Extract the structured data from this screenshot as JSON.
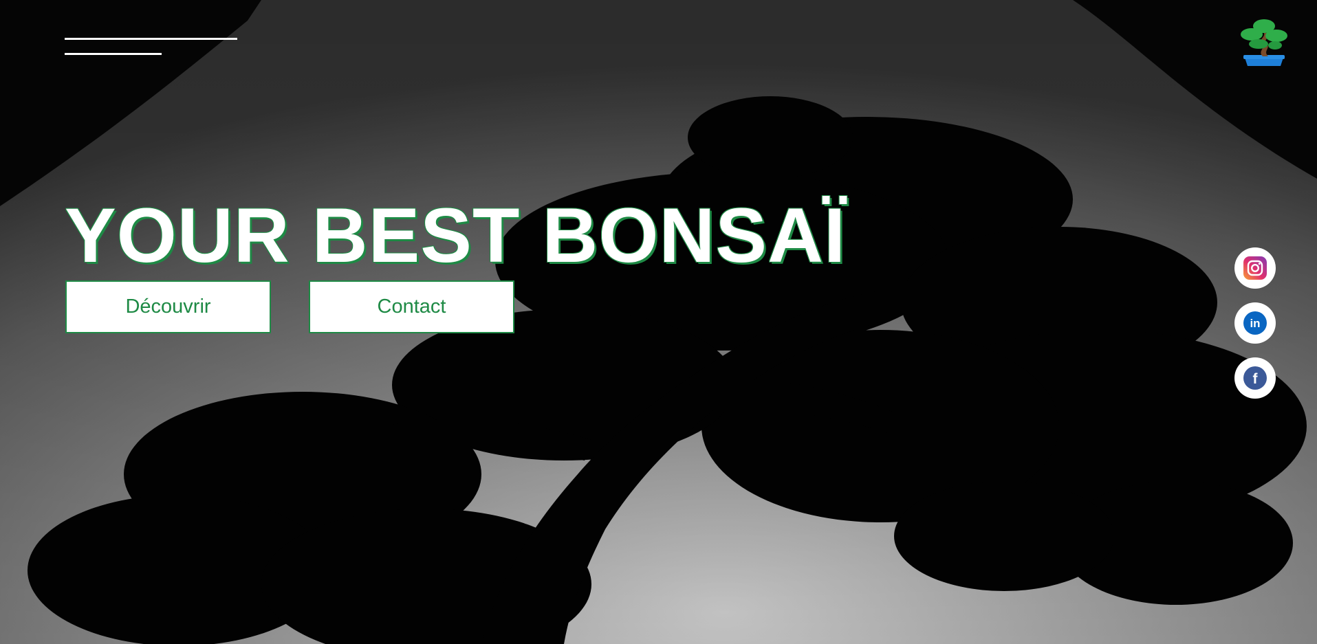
{
  "hero": {
    "title": "YOUR BEST BONSAÏ",
    "background": "monochrome photo of a bonsai tree silhouette against a textured wall"
  },
  "nav": {
    "menu_icon": "hamburger-menu-icon"
  },
  "logo": {
    "icon": "bonsai-tree-logo-icon"
  },
  "buttons": {
    "discover_label": "Découvrir",
    "contact_label": "Contact"
  },
  "social": {
    "instagram": {
      "icon": "instagram-icon"
    },
    "linkedin": {
      "icon": "linkedin-icon",
      "glyph": "in"
    },
    "facebook": {
      "icon": "facebook-icon",
      "glyph": "f"
    }
  },
  "colors": {
    "accent": "#1e8a45",
    "button_bg": "#ffffff",
    "title_text": "#ffffff",
    "background": "#000000",
    "linkedin": "#0a66c2",
    "facebook": "#3b5998"
  }
}
